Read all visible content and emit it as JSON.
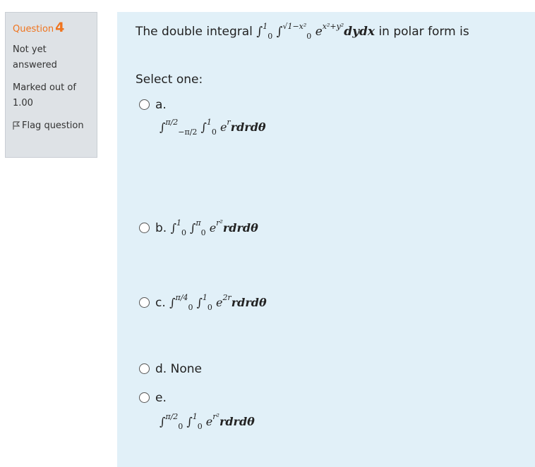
{
  "info": {
    "question_label": "Question",
    "question_number": "4",
    "state_line1": "Not yet",
    "state_line2": "answered",
    "grade_line1": "Marked out of",
    "grade_line2": "1.00",
    "flag_label": "Flag question"
  },
  "question": {
    "text_before": "The double integral",
    "integral_formula": "∫₀¹ ∫₀^√(1−x²) e^(x²+y²) dydx",
    "text_after": "in polar form  is",
    "prompt": "Select one:"
  },
  "options": [
    {
      "letter": "a.",
      "formula": "∫_{−π/2}^{π/2} ∫₀¹ e^r rdrdθ"
    },
    {
      "letter": "b.",
      "formula": "∫₀¹ ∫₀^π e^{r²} rdrdθ"
    },
    {
      "letter": "c.",
      "formula": "∫₀^{π/4} ∫₀¹ e^{2r} rdrdθ"
    },
    {
      "letter": "d.",
      "text": "None"
    },
    {
      "letter": "e.",
      "formula": "∫₀^{π/2} ∫₀¹ e^{r²} rdrdθ"
    }
  ],
  "colors": {
    "accent": "#f0741e",
    "info_bg": "#dee2e6",
    "content_bg": "#e1f0f8"
  }
}
